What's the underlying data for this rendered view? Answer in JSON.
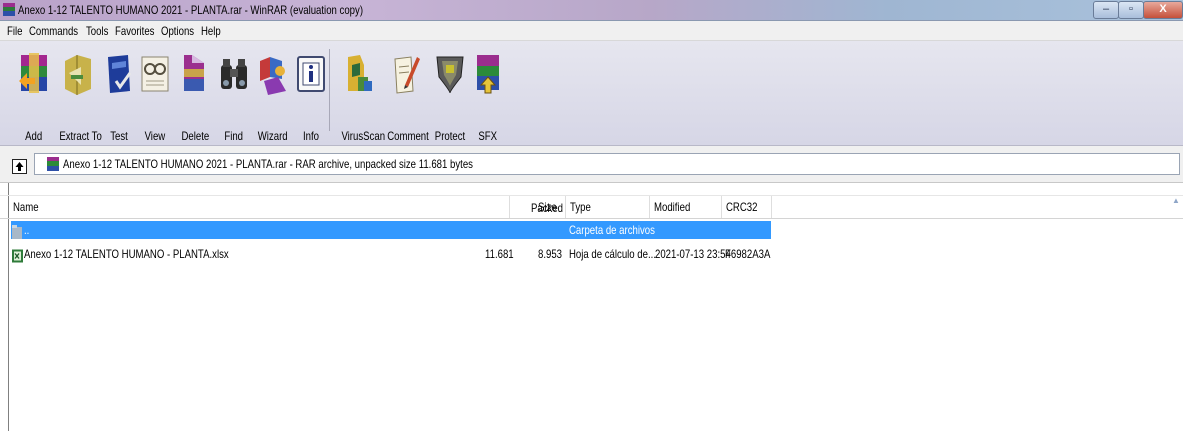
{
  "window": {
    "title": "Anexo 1-12  TALENTO HUMANO 2021 - PLANTA.rar - WinRAR (evaluation copy)",
    "controls": {
      "minimize": "–",
      "maximize": "▫",
      "close": "X"
    }
  },
  "menu": [
    "File",
    "Commands",
    "Tools",
    "Favorites",
    "Options",
    "Help"
  ],
  "toolbar": [
    {
      "label": "Add",
      "icon": "add-archive-icon"
    },
    {
      "label": "Extract To",
      "icon": "extract-to-icon"
    },
    {
      "label": "Test",
      "icon": "test-icon"
    },
    {
      "label": "View",
      "icon": "view-icon"
    },
    {
      "label": "Delete",
      "icon": "delete-icon"
    },
    {
      "label": "Find",
      "icon": "find-icon"
    },
    {
      "label": "Wizard",
      "icon": "wizard-icon"
    },
    {
      "label": "Info",
      "icon": "info-icon"
    },
    {
      "label": "VirusScan",
      "icon": "virusscan-icon"
    },
    {
      "label": "Comment",
      "icon": "comment-icon"
    },
    {
      "label": "Protect",
      "icon": "protect-icon"
    },
    {
      "label": "SFX",
      "icon": "sfx-icon"
    }
  ],
  "address": {
    "text": "Anexo 1-12  TALENTO HUMANO 2021 - PLANTA.rar - RAR archive, unpacked size 11.681 bytes"
  },
  "columns": {
    "name": "Name",
    "size": "Size",
    "packed": "Packed",
    "type": "Type",
    "modified": "Modified",
    "crc": "CRC32"
  },
  "rows": [
    {
      "name": "..",
      "size": "",
      "packed": "",
      "type": "Carpeta de archivos",
      "modified": "",
      "crc": "",
      "selected": true
    },
    {
      "name": "Anexo 1-12  TALENTO HUMANO - PLANTA.xlsx",
      "size": "11.681",
      "packed": "8.953",
      "type": "Hoja de cálculo de...",
      "modified": "2021-07-13 23:54",
      "crc": "F6982A3A",
      "selected": false
    }
  ],
  "colors": {
    "selection": "#3399ff",
    "toolbar_bg": "#dcdce9"
  }
}
